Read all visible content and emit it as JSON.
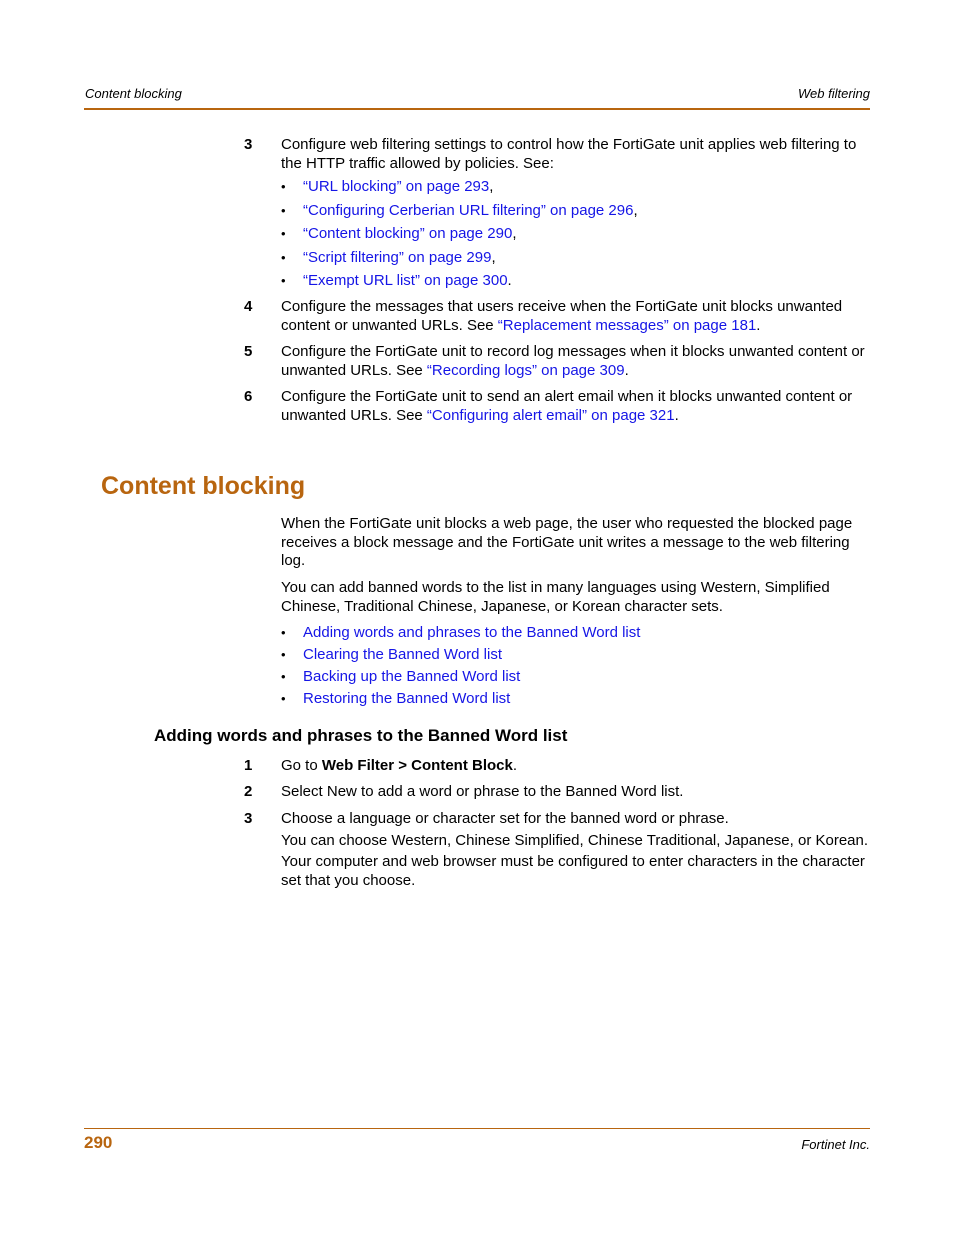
{
  "header": {
    "left": "Content blocking",
    "right": "Web filtering"
  },
  "intro_steps": [
    {
      "num": "3",
      "text": "Configure web filtering settings to control how the FortiGate unit applies web filtering to the HTTP traffic allowed by policies. See:",
      "links": [
        {
          "text": "“URL blocking” on page 293",
          "suffix": ","
        },
        {
          "text": "“Configuring Cerberian URL filtering” on page 296",
          "suffix": ","
        },
        {
          "text": "“Content blocking” on page 290",
          "suffix": ","
        },
        {
          "text": "“Script filtering” on page 299",
          "suffix": ","
        },
        {
          "text": "“Exempt URL list” on page 300",
          "suffix": "."
        }
      ]
    },
    {
      "num": "4",
      "text": "Configure the messages that users receive when the FortiGate unit blocks unwanted content or unwanted URLs. See ",
      "link": "“Replacement messages” on page 181",
      "suffix": "."
    },
    {
      "num": "5",
      "text": "Configure the FortiGate unit to record log messages when it blocks unwanted content or unwanted URLs. See ",
      "link": "“Recording logs” on page 309",
      "suffix": "."
    },
    {
      "num": "6",
      "text": "Configure the FortiGate unit to send an alert email when it blocks unwanted content or unwanted URLs. See ",
      "link": "“Configuring alert email” on page 321",
      "suffix": "."
    }
  ],
  "section": {
    "title": "Content blocking",
    "para1": "When the FortiGate unit blocks a web page, the user who requested the blocked page receives a block message and the FortiGate unit writes a message to the web filtering log.",
    "para2": "You can add banned words to the list in many languages using Western, Simplified Chinese, Traditional Chinese, Japanese, or Korean character sets.",
    "links": [
      "Adding words and phrases to the Banned Word list",
      "Clearing the Banned Word list",
      "Backing up the Banned Word list",
      "Restoring the Banned Word list"
    ]
  },
  "subsection": {
    "title": "Adding words and phrases to the Banned Word list",
    "steps": [
      {
        "num": "1",
        "pre": "Go to ",
        "bold": "Web Filter > Content Block",
        "post": "."
      },
      {
        "num": "2",
        "text": "Select New to add a word or phrase to the Banned Word list."
      },
      {
        "num": "3",
        "text": "Choose a language or character set for the banned word or phrase.",
        "extra1": "You can choose Western, Chinese Simplified, Chinese Traditional, Japanese, or Korean.",
        "extra2": "Your computer and web browser must be configured to enter characters in the character set that you choose."
      }
    ]
  },
  "footer": {
    "page_number": "290",
    "company": "Fortinet Inc."
  }
}
